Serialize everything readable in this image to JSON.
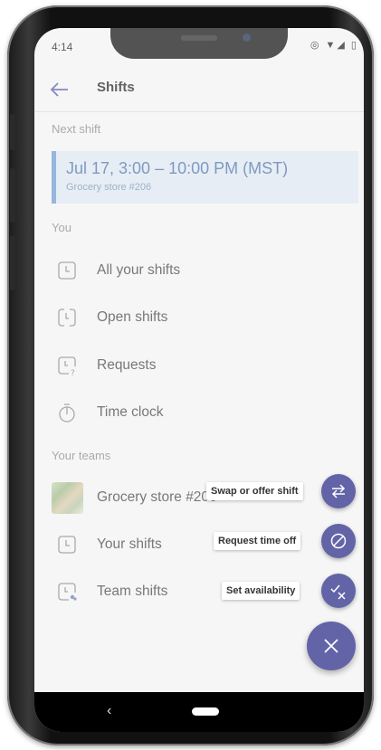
{
  "status": {
    "time": "4:14",
    "icons": "◎ ▼◢ ▯"
  },
  "header": {
    "title": "Shifts",
    "back_icon": "arrow-left-icon"
  },
  "next_shift": {
    "section_label": "Next shift",
    "title": "Jul 17, 3:00 – 10:00 PM (MST)",
    "subtitle": "Grocery store #206"
  },
  "you": {
    "section_label": "You",
    "items": [
      {
        "label": "All your shifts",
        "icon": "clock-icon"
      },
      {
        "label": "Open shifts",
        "icon": "open-shift-icon"
      },
      {
        "label": "Requests",
        "icon": "request-icon"
      },
      {
        "label": "Time clock",
        "icon": "stopwatch-icon"
      }
    ]
  },
  "teams": {
    "section_label": "Your teams",
    "team_name": "Grocery store #206",
    "items": [
      {
        "label": "Your shifts",
        "icon": "clock-icon"
      },
      {
        "label": "Team shifts",
        "icon": "team-shift-icon"
      }
    ]
  },
  "actions": [
    {
      "label": "Swap or offer shift",
      "icon": "swap-icon"
    },
    {
      "label": "Request time off",
      "icon": "block-icon"
    },
    {
      "label": "Set availability",
      "icon": "availability-icon"
    }
  ],
  "colors": {
    "accent": "#6264a7",
    "card_bg": "#dde7f2",
    "card_border": "#6d9bd0"
  }
}
